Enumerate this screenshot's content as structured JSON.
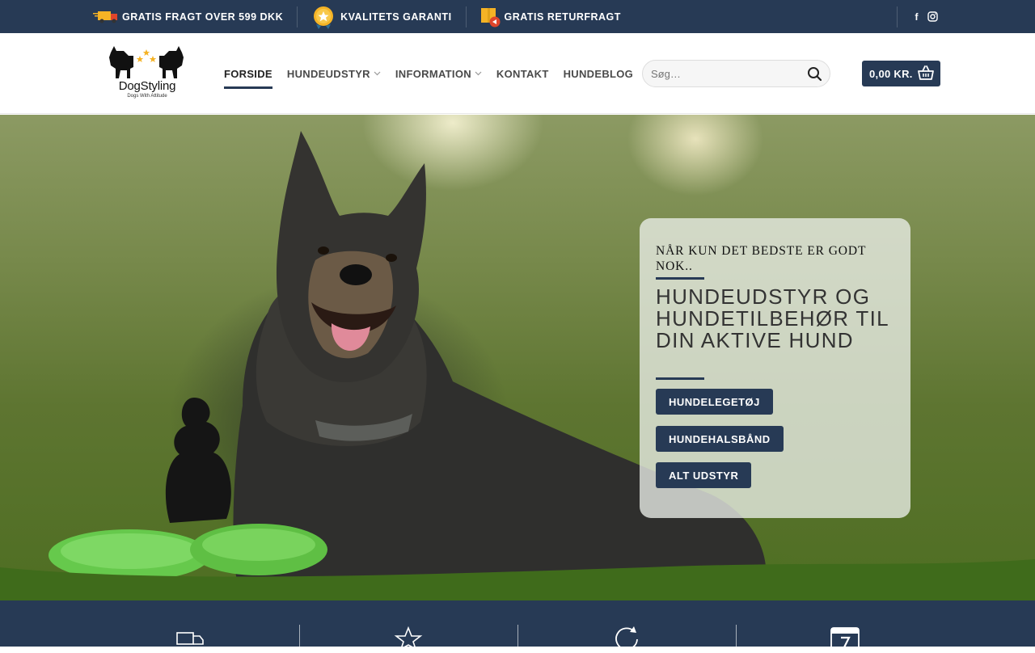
{
  "topbar": {
    "items": [
      {
        "label": "GRATIS FRAGT OVER 599 DKK",
        "icon": "delivery-truck-icon"
      },
      {
        "label": "KVALITETS GARANTI",
        "icon": "quality-medal-icon"
      },
      {
        "label": "GRATIS RETURFRAGT",
        "icon": "return-box-icon"
      }
    ],
    "social": [
      {
        "label": "f",
        "icon": "facebook-icon"
      },
      {
        "label": "◎",
        "icon": "instagram-icon"
      }
    ]
  },
  "header": {
    "logo": {
      "name": "DogStyling",
      "tagline": "Dogs With Attitude"
    },
    "nav": [
      {
        "label": "FORSIDE",
        "active": true,
        "dropdown": false
      },
      {
        "label": "HUNDEUDSTYR",
        "active": false,
        "dropdown": true
      },
      {
        "label": "INFORMATION",
        "active": false,
        "dropdown": true
      },
      {
        "label": "KONTAKT",
        "active": false,
        "dropdown": false
      },
      {
        "label": "HUNDEBLOG",
        "active": false,
        "dropdown": false
      }
    ],
    "search": {
      "placeholder": "Søg…"
    },
    "cart": {
      "label": "0,00 KR."
    }
  },
  "hero": {
    "eyebrow": "NÅR KUN DET BEDSTE ER GODT NOK..",
    "headline": "HUNDEUDSTYR OG HUNDETILBEHØR TIL DIN AKTIVE HUND",
    "buttons": [
      {
        "label": "HUNDELEGETØJ"
      },
      {
        "label": "HUNDEHALSBÅND"
      },
      {
        "label": "ALT UDSTYR"
      }
    ]
  },
  "features": {
    "icons": [
      "delivery-truck-icon",
      "star-icon",
      "refresh-icon",
      "calendar-icon"
    ]
  },
  "colors": {
    "brand_navy": "#273a55",
    "accent_gold": "#f5b325"
  }
}
